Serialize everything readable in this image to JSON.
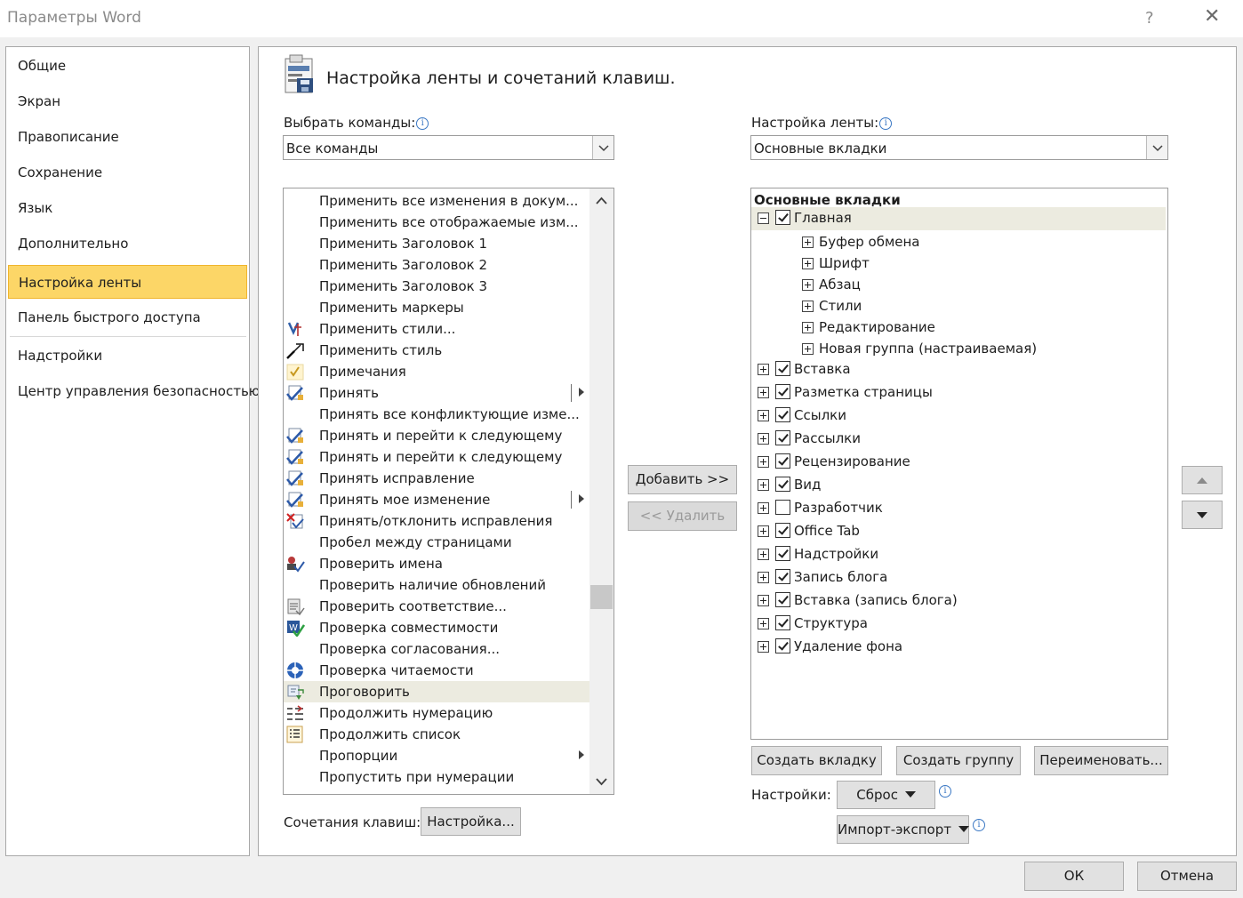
{
  "window": {
    "title": "Параметры Word",
    "help": "?",
    "close": "✕"
  },
  "nav": {
    "items": [
      {
        "label": "Общие"
      },
      {
        "label": "Экран"
      },
      {
        "label": "Правописание"
      },
      {
        "label": "Сохранение"
      },
      {
        "label": "Язык"
      },
      {
        "label": "Дополнительно"
      },
      {
        "label": "Настройка ленты"
      },
      {
        "label": "Панель быстрого доступа"
      },
      {
        "label": "Надстройки"
      },
      {
        "label": "Центр управления безопасностью"
      }
    ],
    "active_index": 6
  },
  "header": {
    "title": "Настройка ленты и сочетаний клавиш."
  },
  "choose_commands": {
    "label": "Выбрать команды:",
    "value": "Все команды"
  },
  "customize_ribbon": {
    "label": "Настройка ленты:",
    "value": "Основные вкладки"
  },
  "commands": [
    {
      "label": "Применить все изменения в докум...",
      "icon": ""
    },
    {
      "label": "Применить все отображаемые изм...",
      "icon": ""
    },
    {
      "label": "Применить Заголовок 1",
      "icon": ""
    },
    {
      "label": "Применить Заголовок 2",
      "icon": ""
    },
    {
      "label": "Применить Заголовок 3",
      "icon": ""
    },
    {
      "label": "Применить маркеры",
      "icon": ""
    },
    {
      "label": "Применить стили...",
      "icon": "styles-icon"
    },
    {
      "label": "Применить стиль",
      "icon": "apply-style-icon"
    },
    {
      "label": "Примечания",
      "icon": "checkmark-icon"
    },
    {
      "label": "Принять",
      "icon": "accept-icon",
      "submenu": true,
      "split": true
    },
    {
      "label": "Принять все конфликтующие изме...",
      "icon": ""
    },
    {
      "label": "Принять и перейти к следующему",
      "icon": "accept-icon"
    },
    {
      "label": "Принять и перейти к следующему",
      "icon": "accept-icon"
    },
    {
      "label": "Принять исправление",
      "icon": "accept-icon"
    },
    {
      "label": "Принять мое изменение",
      "icon": "accept-icon",
      "submenu": true,
      "split": true
    },
    {
      "label": "Принять/отклонить исправления",
      "icon": "accept-reject-icon"
    },
    {
      "label": "Пробел между страницами",
      "icon": ""
    },
    {
      "label": "Проверить имена",
      "icon": "check-names-icon"
    },
    {
      "label": "Проверить наличие обновлений",
      "icon": ""
    },
    {
      "label": "Проверить соответствие...",
      "icon": "check-compat-icon"
    },
    {
      "label": "Проверка совместимости",
      "icon": "compat-check-icon"
    },
    {
      "label": "Проверка согласования...",
      "icon": ""
    },
    {
      "label": "Проверка читаемости",
      "icon": "readability-icon"
    },
    {
      "label": "Проговорить",
      "icon": "speak-icon",
      "selected": true
    },
    {
      "label": "Продолжить нумерацию",
      "icon": "continue-numbering-icon"
    },
    {
      "label": "Продолжить список",
      "icon": "continue-list-icon"
    },
    {
      "label": "Пропорции",
      "icon": "",
      "submenu": true
    },
    {
      "label": "Пропустить при нумерации",
      "icon": ""
    }
  ],
  "buttons": {
    "add": "Добавить >>",
    "remove": "<< Удалить",
    "new_tab": "Создать вкладку",
    "new_group": "Создать группу",
    "rename": "Переименовать...",
    "ok": "ОК",
    "cancel": "Отмена",
    "customize": "Настройка...",
    "reset": "Сброс",
    "import_export": "Импорт-экспорт"
  },
  "ribbon_tree": {
    "header": "Основные вкладки",
    "items": [
      {
        "label": "Главная",
        "level": 0,
        "checked": true,
        "expanded": true
      },
      {
        "label": "Буфер обмена",
        "level": 1
      },
      {
        "label": "Шрифт",
        "level": 1
      },
      {
        "label": "Абзац",
        "level": 1
      },
      {
        "label": "Стили",
        "level": 1
      },
      {
        "label": "Редактирование",
        "level": 1
      },
      {
        "label": "Новая группа (настраиваемая)",
        "level": 1
      },
      {
        "label": "Вставка",
        "level": 0,
        "checked": true
      },
      {
        "label": "Разметка страницы",
        "level": 0,
        "checked": true
      },
      {
        "label": "Ссылки",
        "level": 0,
        "checked": true
      },
      {
        "label": "Рассылки",
        "level": 0,
        "checked": true
      },
      {
        "label": "Рецензирование",
        "level": 0,
        "checked": true
      },
      {
        "label": "Вид",
        "level": 0,
        "checked": true
      },
      {
        "label": "Разработчик",
        "level": 0,
        "checked": false
      },
      {
        "label": "Office Tab",
        "level": 0,
        "checked": true
      },
      {
        "label": "Надстройки",
        "level": 0,
        "checked": true
      },
      {
        "label": "Запись блога",
        "level": 0,
        "checked": true
      },
      {
        "label": "Вставка (запись блога)",
        "level": 0,
        "checked": true
      },
      {
        "label": "Структура",
        "level": 0,
        "checked": true
      },
      {
        "label": "Удаление фона",
        "level": 0,
        "checked": true
      }
    ]
  },
  "settings": {
    "label": "Настройки:"
  },
  "shortcuts": {
    "label": "Сочетания клавиш:"
  },
  "colors": {
    "nav_active": "#fcd667",
    "selected_row": "#ecebe0",
    "info": "#3b78c4"
  }
}
